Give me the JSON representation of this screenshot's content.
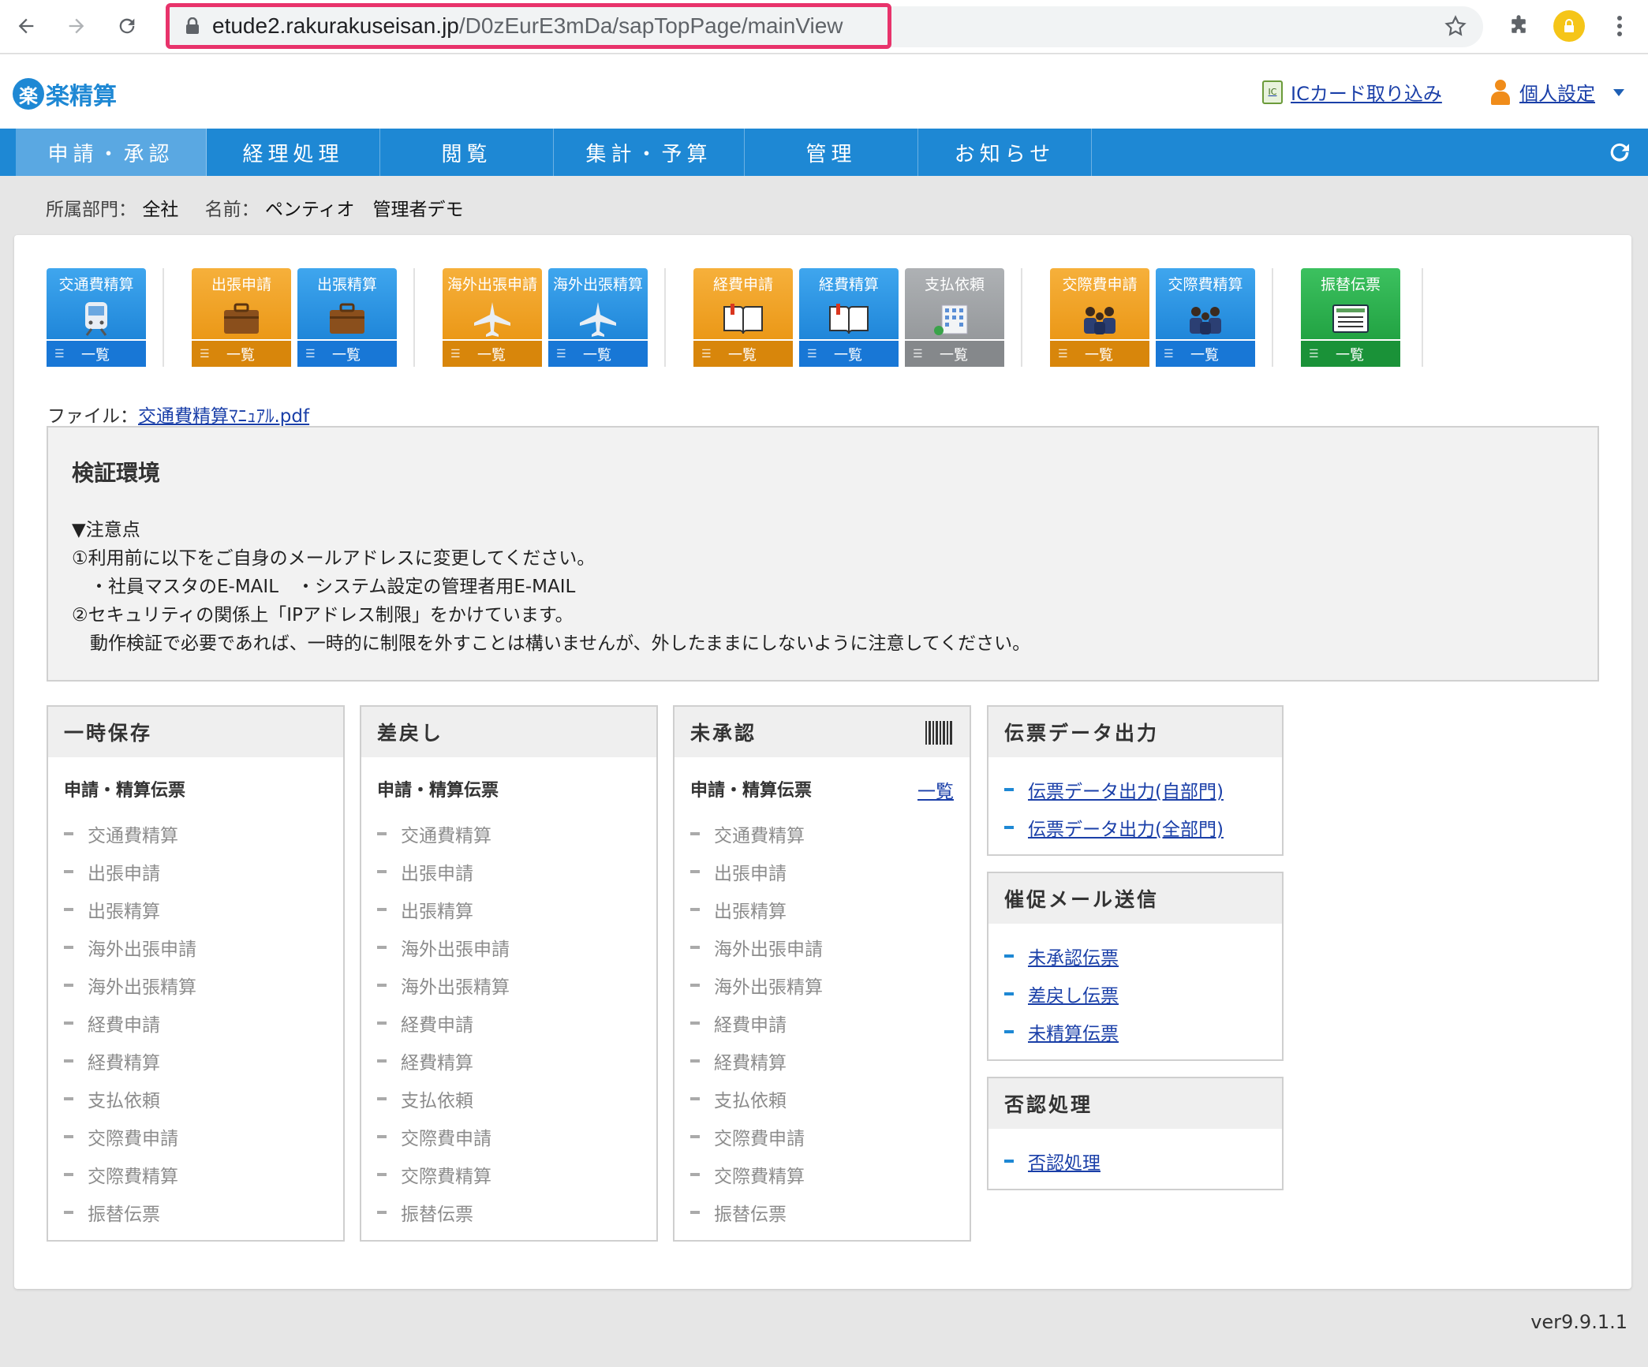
{
  "browser": {
    "url_host": "etude2.rakurakuseisan.jp",
    "url_path": "/D0zEurE3mDa/sapTopPage/mainView"
  },
  "header": {
    "logo_mark": "楽",
    "logo_text": "楽精算",
    "ic_card_label": "ICカード取り込み",
    "personal_settings_label": "個人設定"
  },
  "nav": {
    "tabs": [
      "申請・承認",
      "経理処理",
      "閲覧",
      "集計・予算",
      "管理",
      "お知らせ"
    ]
  },
  "user": {
    "dept_label": "所属部門：",
    "dept_value": "全社",
    "name_label": "名前：",
    "name_value": "ペンティオ　管理者デモ"
  },
  "tiles": [
    {
      "title": "交通費精算",
      "list_label": "一覧",
      "color": "blue",
      "icon": "train-icon"
    },
    {
      "title": "出張申請",
      "list_label": "一覧",
      "color": "orange",
      "icon": "briefcase-icon"
    },
    {
      "title": "出張精算",
      "list_label": "一覧",
      "color": "blue",
      "icon": "briefcase-icon"
    },
    {
      "title": "海外出張申請",
      "list_label": "一覧",
      "color": "orange",
      "icon": "airplane-icon"
    },
    {
      "title": "海外出張精算",
      "list_label": "一覧",
      "color": "blue",
      "icon": "airplane-icon"
    },
    {
      "title": "経費申請",
      "list_label": "一覧",
      "color": "orange",
      "icon": "book-icon"
    },
    {
      "title": "経費精算",
      "list_label": "一覧",
      "color": "blue",
      "icon": "book-icon"
    },
    {
      "title": "支払依頼",
      "list_label": "一覧",
      "color": "gray",
      "icon": "building-icon"
    },
    {
      "title": "交際費申請",
      "list_label": "一覧",
      "color": "orange",
      "icon": "people-icon"
    },
    {
      "title": "交際費精算",
      "list_label": "一覧",
      "color": "blue",
      "icon": "people-icon"
    },
    {
      "title": "振替伝票",
      "list_label": "一覧",
      "color": "green",
      "icon": "voucher-icon"
    }
  ],
  "file": {
    "label": "ファイル：",
    "link": "交通費精算ﾏﾆｭｱﾙ.pdf"
  },
  "notice": {
    "title": "検証環境",
    "body": "▼注意点\n①利用前に以下をご自身のメールアドレスに変更してください。\n　・社員マスタのE-MAIL　・システム設定の管理者用E-MAIL\n②セキュリティの関係上「IPアドレス制限」をかけています。\n　動作検証で必要であれば、一時的に制限を外すことは構いませんが、外したままにしないように注意してください。"
  },
  "boxes": {
    "temp_saved": {
      "title": "一時保存",
      "sub": "申請・精算伝票"
    },
    "returned": {
      "title": "差戻し",
      "sub": "申請・精算伝票"
    },
    "unapproved": {
      "title": "未承認",
      "sub": "申請・精算伝票",
      "list_link": "一覧"
    },
    "items": [
      "交通費精算",
      "出張申請",
      "出張精算",
      "海外出張申請",
      "海外出張精算",
      "経費申請",
      "経費精算",
      "支払依頼",
      "交際費申請",
      "交際費精算",
      "振替伝票"
    ],
    "export": {
      "title": "伝票データ出力",
      "links": [
        "伝票データ出力(自部門)",
        "伝票データ出力(全部門)"
      ]
    },
    "reminder": {
      "title": "催促メール送信",
      "links": [
        "未承認伝票",
        "差戻し伝票",
        "未精算伝票"
      ]
    },
    "reject": {
      "title": "否認処理",
      "links": [
        "否認処理"
      ]
    }
  },
  "version": "ver9.9.1.1"
}
